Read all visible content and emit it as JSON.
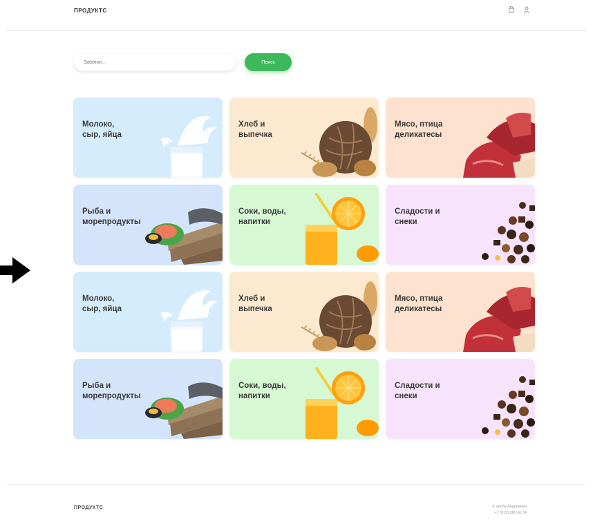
{
  "header": {
    "logo": "ПРОДУКТС",
    "icons": [
      "cart-icon",
      "user-icon"
    ]
  },
  "search": {
    "placeholder": "Заботки...",
    "button_label": "Поиск"
  },
  "categories": [
    {
      "label": "Молоко,\nсыр, яйца",
      "bg": "#d4ecfb",
      "icon": "milk-icon"
    },
    {
      "label": "Хлеб и\nвыпечка",
      "bg": "#fde9cf",
      "icon": "bread-icon"
    },
    {
      "label": "Мясо, птица\nделикатесы",
      "bg": "#fde2cf",
      "icon": "meat-icon"
    },
    {
      "label": "Рыба и\nморепродукты",
      "bg": "#d3e4fb",
      "icon": "fish-icon"
    },
    {
      "label": "Соки, воды,\nнапитки",
      "bg": "#d6f8d3",
      "icon": "juice-icon"
    },
    {
      "label": "Сладости и\nснеки",
      "bg": "#f7e4fc",
      "icon": "sweets-icon"
    },
    {
      "label": "Молоко,\nсыр, яйца",
      "bg": "#d4ecfb",
      "icon": "milk-icon"
    },
    {
      "label": "Хлеб и\nвыпечка",
      "bg": "#fde9cf",
      "icon": "bread-icon"
    },
    {
      "label": "Мясо, птица\nделикатесы",
      "bg": "#fde2cf",
      "icon": "meat-icon"
    },
    {
      "label": "Рыба и\nморепродукты",
      "bg": "#d3e4fb",
      "icon": "fish-icon"
    },
    {
      "label": "Соки, воды,\nнапитки",
      "bg": "#d6f8d3",
      "icon": "juice-icon"
    },
    {
      "label": "Сладости и\nснеки",
      "bg": "#f7e4fc",
      "icon": "sweets-icon"
    }
  ],
  "footer": {
    "logo": "ПРОДУКТС",
    "contact_line1": "© необу Андреевич",
    "contact_line2": "+7 (912) 360 60 34"
  },
  "colors": {
    "accent": "#3cb95a",
    "divider": "#ececec"
  }
}
